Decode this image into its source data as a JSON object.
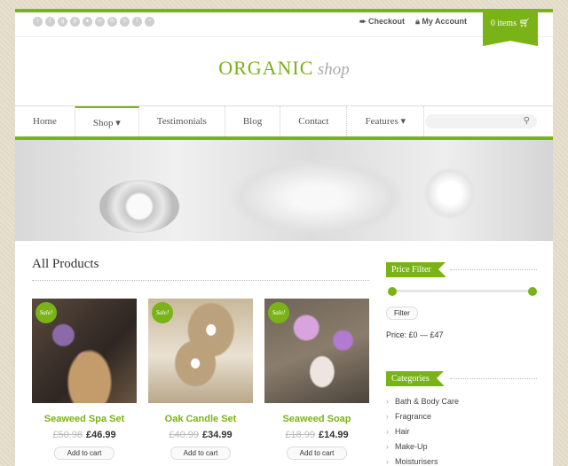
{
  "header": {
    "social_icons": [
      "twitter-icon",
      "facebook-icon",
      "google-plus-icon",
      "pinterest-icon",
      "dribbble-icon",
      "flickr-icon",
      "linkedin-icon",
      "vimeo-icon",
      "tumblr-icon",
      "rss-icon"
    ],
    "checkout": "Checkout",
    "my_account": "My Account",
    "cart": "0 items"
  },
  "logo": {
    "primary": "ORGANIC",
    "secondary": "shop"
  },
  "nav": {
    "items": [
      {
        "label": "Home"
      },
      {
        "label": "Shop ▾"
      },
      {
        "label": "Testimonials"
      },
      {
        "label": "Blog"
      },
      {
        "label": "Contact"
      },
      {
        "label": "Features ▾"
      }
    ],
    "search_placeholder": ""
  },
  "main": {
    "title": "All Products",
    "products": [
      {
        "name": "Seaweed Spa Set",
        "old_price": "£50.98",
        "price": "£46.99",
        "badge": "Sale!",
        "button": "Add to cart"
      },
      {
        "name": "Oak Candle Set",
        "old_price": "£40.99",
        "price": "£34.99",
        "badge": "Sale!",
        "button": "Add to cart"
      },
      {
        "name": "Seaweed Soap",
        "old_price": "£18.99",
        "price": "£14.99",
        "badge": "Sale!",
        "button": "Add to cart"
      }
    ]
  },
  "sidebar": {
    "price_filter_title": "Price Filter",
    "filter_button": "Filter",
    "price_range": "Price: £0 — £47",
    "categories_title": "Categories",
    "categories": [
      "Bath & Body Care",
      "Fragrance",
      "Hair",
      "Make-Up",
      "Moisturisers"
    ]
  },
  "colors": {
    "accent": "#7ab317"
  }
}
